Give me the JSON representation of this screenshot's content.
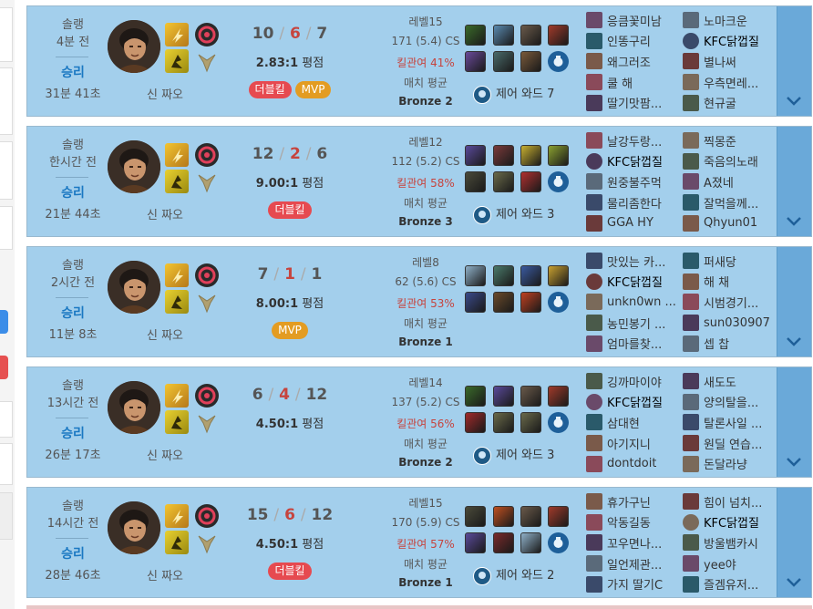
{
  "matches": [
    {
      "game_type": "솔랭",
      "time_ago": "4분 전",
      "result": "승리",
      "duration": "31분 41초",
      "champion": "신 짜오",
      "kills": "10",
      "deaths": "6",
      "assists": "7",
      "sep": "/",
      "ratio": "2.83:1",
      "ratio_suffix": "평점",
      "badges": [
        {
          "label": "더블킬",
          "color": "#e64a50"
        },
        {
          "label": "MVP",
          "color": "#e39c22"
        }
      ],
      "level": "레벨15",
      "cs": "171 (5.4) CS",
      "kill_participation": "킬관여 41%",
      "match_avg": "매치 평균",
      "tier": "Bronze 2",
      "items": [
        "#3a6a2a",
        "#5a8ab0",
        "#6a5a4a",
        "#a03a2a",
        "#6a4a9a",
        "#4a6a6a",
        "#7a5a3a",
        "#2a5a8a"
      ],
      "ward": "제어 와드 7",
      "team1": [
        "응큼꽃미남",
        "인똥구리",
        "왜그러조",
        "쿨 해",
        "딸기맛팜..."
      ],
      "team2": [
        "노마크운",
        "KFC닭껍질",
        "별나써",
        "우측면레...",
        "현규굴"
      ]
    },
    {
      "game_type": "솔랭",
      "time_ago": "한시간 전",
      "result": "승리",
      "duration": "21분 44초",
      "champion": "신 짜오",
      "kills": "12",
      "deaths": "2",
      "assists": "6",
      "sep": "/",
      "ratio": "9.00:1",
      "ratio_suffix": "평점",
      "badges": [
        {
          "label": "더블킬",
          "color": "#e64a50"
        }
      ],
      "level": "레벨12",
      "cs": "112 (5.2) CS",
      "kill_participation": "킬관여 58%",
      "match_avg": "매치 평균",
      "tier": "Bronze 3",
      "items": [
        "#5a4a9a",
        "#7a3a3a",
        "#c8b030",
        "#8aa030",
        "#4a4a3a",
        "#6a6a4a",
        "#b03030",
        "#2a5a8a"
      ],
      "ward": "제어 와드 3",
      "team1": [
        "날강두랑...",
        "KFC닭껍질",
        "원중불주먹",
        "물리좀한다",
        "GGA HY"
      ],
      "team2": [
        "찍몽준",
        "죽음의노래",
        "A졌네",
        "잘먹을께...",
        "Qhyun01"
      ]
    },
    {
      "game_type": "솔랭",
      "time_ago": "2시간 전",
      "result": "승리",
      "duration": "11분 8초",
      "champion": "신 짜오",
      "kills": "7",
      "deaths": "1",
      "assists": "1",
      "sep": "/",
      "ratio": "8.00:1",
      "ratio_suffix": "평점",
      "badges": [
        {
          "label": "MVP",
          "color": "#e39c22"
        }
      ],
      "level": "레벨8",
      "cs": "62 (5.6) CS",
      "kill_participation": "킬관여 53%",
      "match_avg": "매치 평균",
      "tier": "Bronze 1",
      "items": [
        "#8fb0c8",
        "#4a7a6a",
        "#3a5aa0",
        "#c8a030",
        "#3a4a8a",
        "#6a4a2a",
        "#c04020",
        "#2a5a8a"
      ],
      "ward": "",
      "team1": [
        "맛있는 카...",
        "KFC닭껍질",
        "unkn0wn ...",
        "농민봉기 ...",
        "엄마를찾..."
      ],
      "team2": [
        "퍼새당",
        "해 채",
        "시범경기...",
        "sun030907",
        "셉 찹"
      ]
    },
    {
      "game_type": "솔랭",
      "time_ago": "13시간 전",
      "result": "승리",
      "duration": "26분 17초",
      "champion": "신 짜오",
      "kills": "6",
      "deaths": "4",
      "assists": "12",
      "sep": "/",
      "ratio": "4.50:1",
      "ratio_suffix": "평점",
      "badges": [],
      "level": "레벨14",
      "cs": "137 (5.2) CS",
      "kill_participation": "킬관여 56%",
      "match_avg": "매치 평균",
      "tier": "Bronze 2",
      "items": [
        "#3a6a2a",
        "#5a4a9a",
        "#6a5a4a",
        "#a03a2a",
        "#a02a2a",
        "#6a6a4a",
        "#6a6a4a",
        "#2a5a8a"
      ],
      "ward": "제어 와드 3",
      "team1": [
        "깅까마이야",
        "KFC닭껍질",
        "삼대현",
        "아기지니",
        "dontdoit"
      ],
      "team2": [
        "새도도",
        "양의탈을...",
        "탈론사일 ...",
        "원딜 연습...",
        "돈달라냥"
      ]
    },
    {
      "game_type": "솔랭",
      "time_ago": "14시간 전",
      "result": "승리",
      "duration": "28분 46초",
      "champion": "신 짜오",
      "kills": "15",
      "deaths": "6",
      "assists": "12",
      "sep": "/",
      "ratio": "4.50:1",
      "ratio_suffix": "평점",
      "badges": [
        {
          "label": "더블킬",
          "color": "#e64a50"
        }
      ],
      "level": "레벨15",
      "cs": "170 (5.9) CS",
      "kill_participation": "킬관여 57%",
      "match_avg": "매치 평균",
      "tier": "Bronze 1",
      "items": [
        "#4a4a3a",
        "#c05020",
        "#6a5a4a",
        "#a03a2a",
        "#5a4a9a",
        "#7a2a2a",
        "#8fb0c8",
        "#2a5a8a"
      ],
      "ward": "제어 와드 2",
      "team1": [
        "휴가구닌",
        "악동길동",
        "꼬우면나...",
        "일언제관...",
        "가지 딸기C"
      ],
      "team2": [
        "힘이 넘치...",
        "KFC닭껍질",
        "방울뱀카시",
        "yee야",
        "즐겜유저..."
      ]
    }
  ],
  "colors": {
    "card_bg": "#a3cfec",
    "win_text": "#1a78c2",
    "death_red": "#c6443e",
    "expand_bg": "#6aa9d9"
  },
  "icons": {
    "champion": "champion-portrait-icon",
    "spell1": "flash-spell-icon",
    "spell2": "ignite-spell-icon",
    "rune1": "lethal-tempo-rune-icon",
    "rune2": "precision-rune-icon",
    "ward": "control-ward-icon",
    "expand": "chevron-down-icon"
  },
  "me_name": "KFC닭껍질"
}
